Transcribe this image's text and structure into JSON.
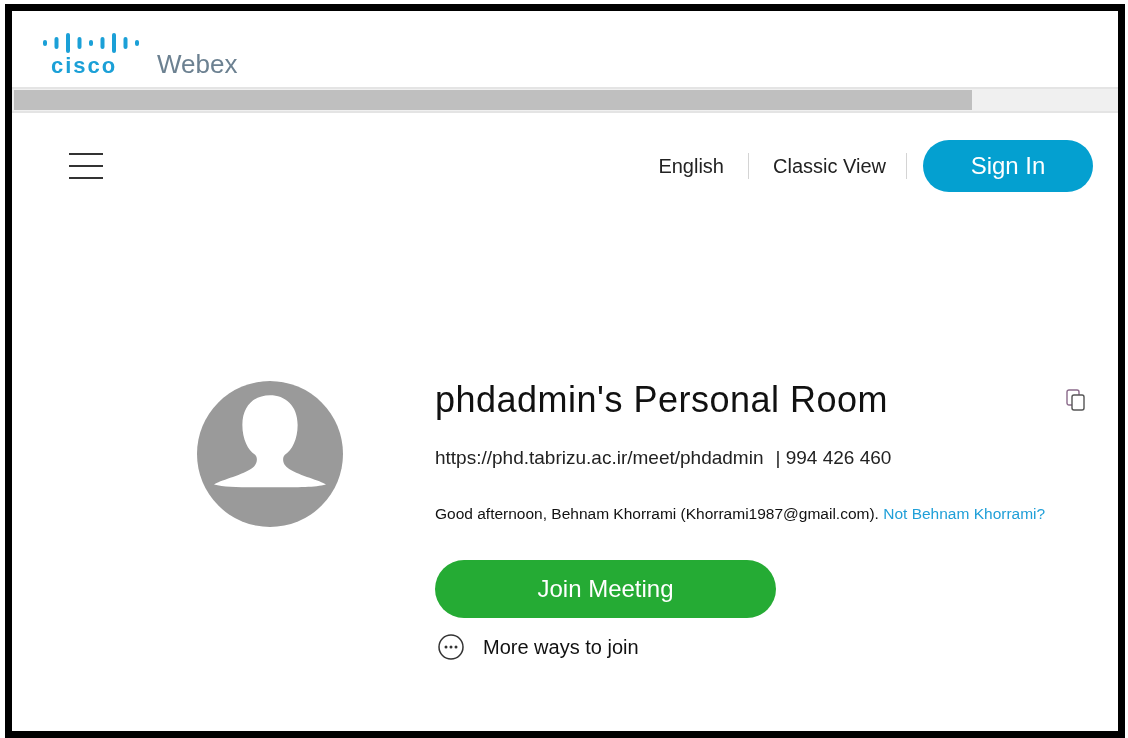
{
  "logo": {
    "brand": "cisco",
    "product": "Webex"
  },
  "nav": {
    "links": [
      "English",
      "Classic View"
    ],
    "sign_in": "Sign In"
  },
  "room": {
    "title": "phdadmin's Personal Room",
    "url": "https://phd.tabrizu.ac.ir/meet/phdadmin",
    "meeting_number": "| 994 426 460",
    "greeting": "Good afternoon, Behnam Khorrami (Khorrami1987@gmail.com).",
    "greeting_link": "Not Behnam Khorrami?",
    "join_button": "Join Meeting",
    "more_ways": "More ways to join"
  }
}
